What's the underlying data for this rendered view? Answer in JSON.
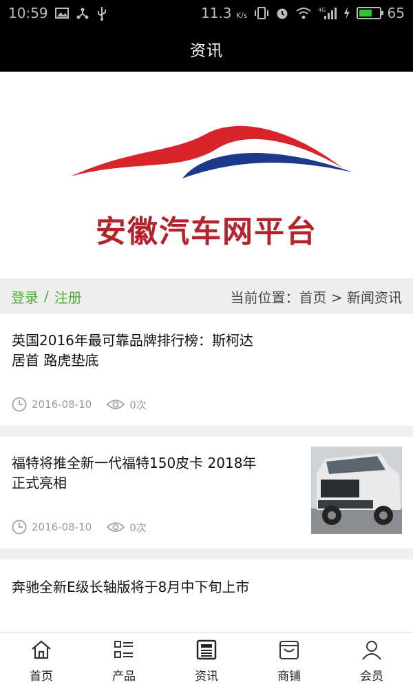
{
  "status_bar": {
    "time": "10:59",
    "net_speed": "11.3",
    "net_unit": "K/s",
    "signal_label": "4G",
    "battery_level": 0.65,
    "battery_text": "65"
  },
  "header": {
    "title": "资讯"
  },
  "banner": {
    "logo_text": "安徽汽车网平台",
    "colors": {
      "red": "#d9242b",
      "blue": "#1d3a8a"
    }
  },
  "location_bar": {
    "login": "登录",
    "separator": "/",
    "register": "注册",
    "prefix": "当前位置：",
    "home": "首页",
    "arrow": ">",
    "current": "新闻资讯"
  },
  "articles": [
    {
      "title_line1": "英国2016年最可靠品牌排行榜：斯柯达",
      "title_line2": "居首 路虎垫底",
      "date": "2016-08-10",
      "views": "0次",
      "has_image": false
    },
    {
      "title_line1": "福特将推全新一代福特150皮卡 2018年",
      "title_line2": "正式亮相",
      "date": "2016-08-10",
      "views": "0次",
      "has_image": true
    },
    {
      "title_line1": "奔驰全新E级长轴版将于8月中下旬上市",
      "title_line2": "",
      "has_image": false
    }
  ],
  "bottom_nav": [
    {
      "label": "首页",
      "icon": "home-icon"
    },
    {
      "label": "产品",
      "icon": "list-icon"
    },
    {
      "label": "资讯",
      "icon": "news-icon"
    },
    {
      "label": "商铺",
      "icon": "shop-icon"
    },
    {
      "label": "会员",
      "icon": "user-icon"
    }
  ],
  "accent_color": "#4caf3a"
}
